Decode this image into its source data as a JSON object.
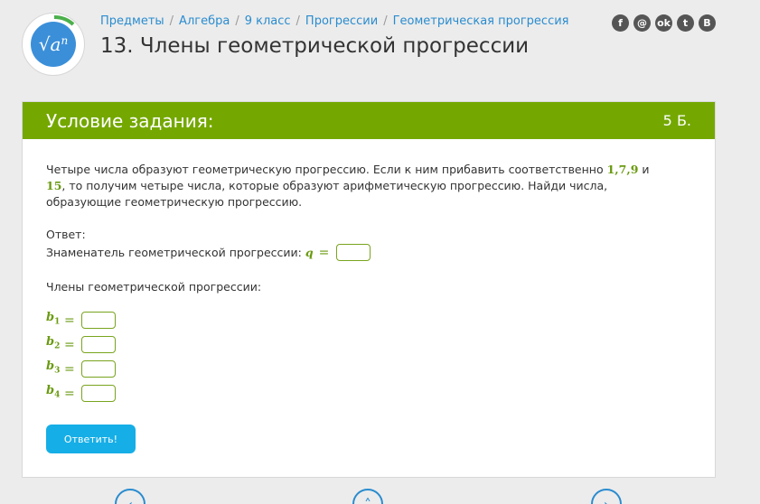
{
  "header": {
    "breadcrumbs": [
      "Предметы",
      "Алгебра",
      "9 класс",
      "Прогрессии",
      "Геометрическая прогрессия"
    ],
    "title": "13. Члены геометрической прогрессии",
    "logo_text": "√a",
    "logo_sup": "n",
    "socials": [
      {
        "icon": "facebook-icon",
        "glyph": "f"
      },
      {
        "icon": "email-icon",
        "glyph": "@"
      },
      {
        "icon": "odnoklassniki-icon",
        "glyph": "ok"
      },
      {
        "icon": "twitter-icon",
        "glyph": "t"
      },
      {
        "icon": "vkontakte-icon",
        "glyph": "B"
      }
    ]
  },
  "card": {
    "title": "Условие задания:",
    "points": "5 Б.",
    "task_part1": "Четыре числа образуют геометрическую прогрессию. Если к ним прибавить соответственно ",
    "task_math1": "1,7,9",
    "task_and": " и ",
    "task_math2": "15",
    "task_part2": ", то получим четыре числа, которые образуют арифметическую прогрессию. Найди числа, образующие геометрическую прогрессию.",
    "answer_label": "Ответ:",
    "ratio_label": "Знаменатель геометрической прогрессии:",
    "ratio_symbol": "q",
    "equals": "=",
    "members_label": "Члены геометрической прогрессии:",
    "members": [
      {
        "name": "b",
        "index": "1"
      },
      {
        "name": "b",
        "index": "2"
      },
      {
        "name": "b",
        "index": "3"
      },
      {
        "name": "b",
        "index": "4"
      }
    ],
    "submit_label": "Ответить!"
  },
  "colors": {
    "accent_green": "#74a800",
    "link_blue": "#2a8ccf",
    "button_blue": "#16aee6"
  }
}
